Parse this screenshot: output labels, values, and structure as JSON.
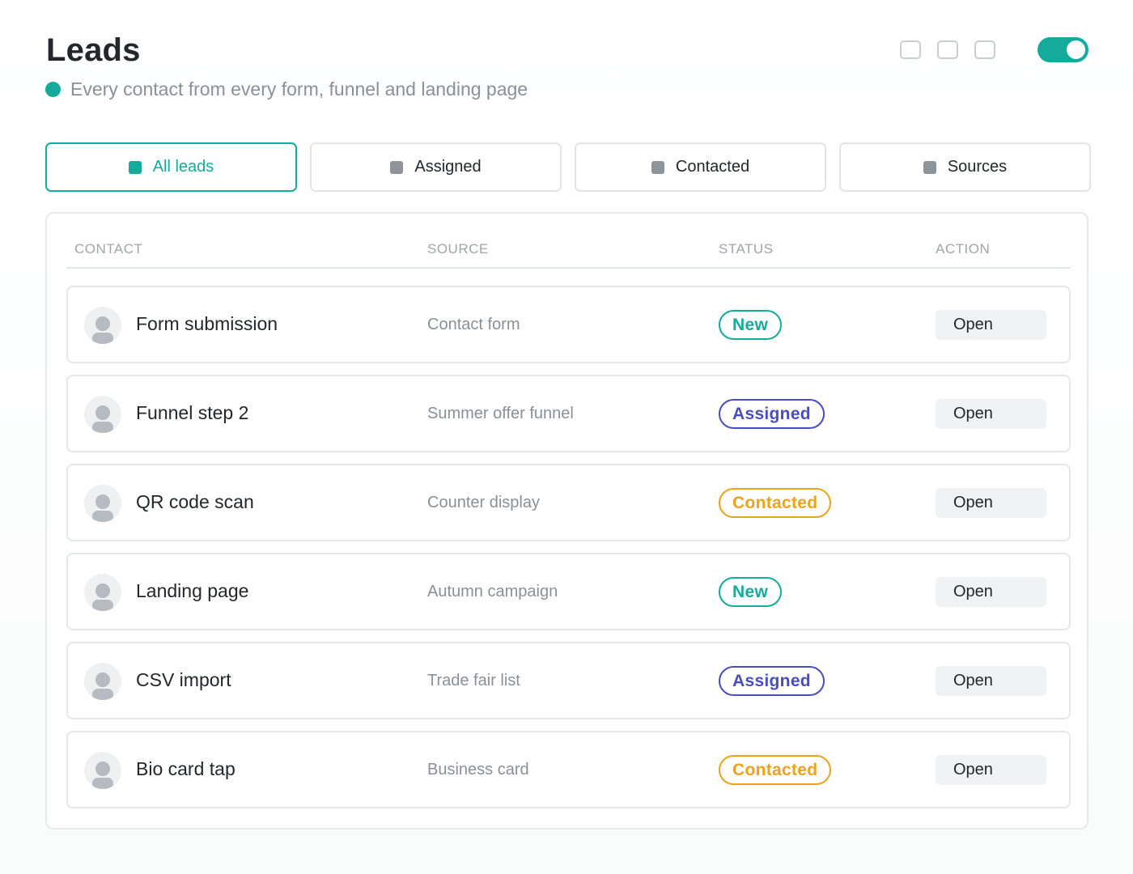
{
  "header": {
    "title": "Leads",
    "subtitle": "Every contact from every form, funnel and landing page"
  },
  "toggle": {
    "on": true
  },
  "tabs": [
    {
      "label": "All leads",
      "active": true
    },
    {
      "label": "Assigned",
      "active": false
    },
    {
      "label": "Contacted",
      "active": false
    },
    {
      "label": "Sources",
      "active": false
    }
  ],
  "table": {
    "columns": {
      "contact": "CONTACT",
      "source": "SOURCE",
      "status": "STATUS",
      "action": "ACTION"
    },
    "rows": [
      {
        "contact": "Form submission",
        "source": "Contact form",
        "status": "New",
        "action": "Open"
      },
      {
        "contact": "Funnel step 2",
        "source": "Summer offer funnel",
        "status": "Assigned",
        "action": "Open"
      },
      {
        "contact": "QR code scan",
        "source": "Counter display",
        "status": "Contacted",
        "action": "Open"
      },
      {
        "contact": "Landing page",
        "source": "Autumn campaign",
        "status": "New",
        "action": "Open"
      },
      {
        "contact": "CSV import",
        "source": "Trade fair list",
        "status": "Assigned",
        "action": "Open"
      },
      {
        "contact": "Bio card tap",
        "source": "Business card",
        "status": "Contacted",
        "action": "Open"
      }
    ]
  },
  "colors": {
    "accent": "#14ab9c",
    "assigned": "#4a4dbe",
    "contacted": "#eda21b"
  },
  "icons": {
    "live_indicator": "status-dot-icon",
    "tab_icon": "square-icon",
    "avatar": "user-avatar-icon"
  }
}
